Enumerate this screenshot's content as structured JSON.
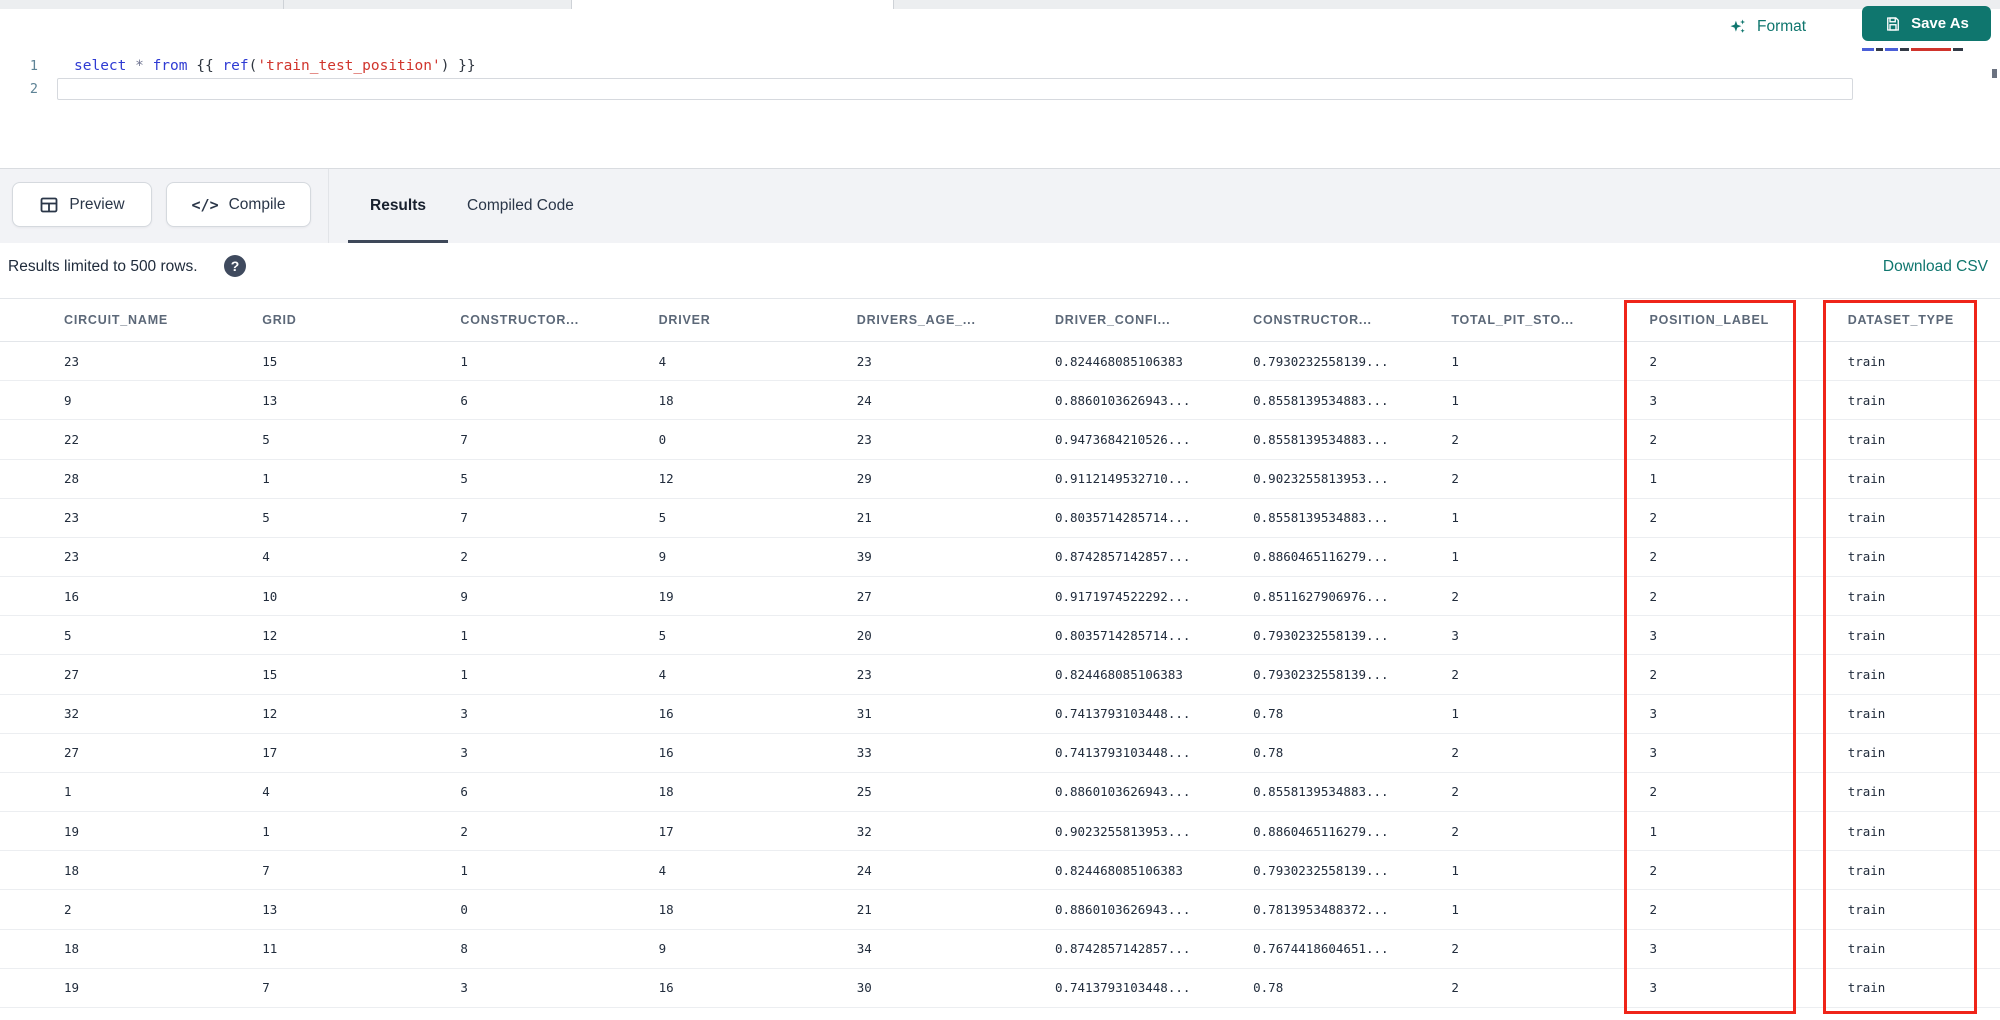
{
  "toolbar": {
    "format_label": "Format",
    "save_as_label": "Save As"
  },
  "editor": {
    "line1_number": "1",
    "line2_number": "2",
    "code_tokens": [
      {
        "text": "select ",
        "type": "keyword"
      },
      {
        "text": "* ",
        "type": "operator"
      },
      {
        "text": "from ",
        "type": "keyword"
      },
      {
        "text": "{{ ",
        "type": "plain"
      },
      {
        "text": "ref",
        "type": "function"
      },
      {
        "text": "(",
        "type": "plain"
      },
      {
        "text": "'train_test_position'",
        "type": "string"
      },
      {
        "text": ") ",
        "type": "plain"
      },
      {
        "text": "}}",
        "type": "plain"
      }
    ]
  },
  "panel": {
    "preview_label": "Preview",
    "compile_label": "Compile",
    "tabs": [
      {
        "label": "Results",
        "active": true
      },
      {
        "label": "Compiled Code",
        "active": false
      }
    ]
  },
  "results": {
    "limit_text": "Results limited to 500 rows.",
    "help_glyph": "?",
    "download_label": "Download CSV"
  },
  "table": {
    "columns": [
      "CIRCUIT_NAME",
      "GRID",
      "CONSTRUCTOR...",
      "DRIVER",
      "DRIVERS_AGE_...",
      "DRIVER_CONFI...",
      "CONSTRUCTOR...",
      "TOTAL_PIT_STO...",
      "POSITION_LABEL",
      "DATASET_TYPE"
    ],
    "rows": [
      [
        "23",
        "15",
        "1",
        "4",
        "23",
        "0.824468085106383",
        "0.7930232558139...",
        "1",
        "2",
        "train"
      ],
      [
        "9",
        "13",
        "6",
        "18",
        "24",
        "0.8860103626943...",
        "0.8558139534883...",
        "1",
        "3",
        "train"
      ],
      [
        "22",
        "5",
        "7",
        "0",
        "23",
        "0.9473684210526...",
        "0.8558139534883...",
        "2",
        "2",
        "train"
      ],
      [
        "28",
        "1",
        "5",
        "12",
        "29",
        "0.9112149532710...",
        "0.9023255813953...",
        "2",
        "1",
        "train"
      ],
      [
        "23",
        "5",
        "7",
        "5",
        "21",
        "0.8035714285714...",
        "0.8558139534883...",
        "1",
        "2",
        "train"
      ],
      [
        "23",
        "4",
        "2",
        "9",
        "39",
        "0.8742857142857...",
        "0.8860465116279...",
        "1",
        "2",
        "train"
      ],
      [
        "16",
        "10",
        "9",
        "19",
        "27",
        "0.9171974522292...",
        "0.8511627906976...",
        "2",
        "2",
        "train"
      ],
      [
        "5",
        "12",
        "1",
        "5",
        "20",
        "0.8035714285714...",
        "0.7930232558139...",
        "3",
        "3",
        "train"
      ],
      [
        "27",
        "15",
        "1",
        "4",
        "23",
        "0.824468085106383",
        "0.7930232558139...",
        "2",
        "2",
        "train"
      ],
      [
        "32",
        "12",
        "3",
        "16",
        "31",
        "0.7413793103448...",
        "0.78",
        "1",
        "3",
        "train"
      ],
      [
        "27",
        "17",
        "3",
        "16",
        "33",
        "0.7413793103448...",
        "0.78",
        "2",
        "3",
        "train"
      ],
      [
        "1",
        "4",
        "6",
        "18",
        "25",
        "0.8860103626943...",
        "0.8558139534883...",
        "2",
        "2",
        "train"
      ],
      [
        "19",
        "1",
        "2",
        "17",
        "32",
        "0.9023255813953...",
        "0.8860465116279...",
        "2",
        "1",
        "train"
      ],
      [
        "18",
        "7",
        "1",
        "4",
        "24",
        "0.824468085106383",
        "0.7930232558139...",
        "1",
        "2",
        "train"
      ],
      [
        "2",
        "13",
        "0",
        "18",
        "21",
        "0.8860103626943...",
        "0.7813953488372...",
        "1",
        "2",
        "train"
      ],
      [
        "18",
        "11",
        "8",
        "9",
        "34",
        "0.8742857142857...",
        "0.7674418604651...",
        "2",
        "3",
        "train"
      ],
      [
        "19",
        "7",
        "3",
        "16",
        "30",
        "0.7413793103448...",
        "0.78",
        "2",
        "3",
        "train"
      ]
    ],
    "highlighted_columns": [
      "POSITION_LABEL",
      "DATASET_TYPE"
    ]
  },
  "colors": {
    "accent_teal": "#0f766e",
    "annotation_red": "#ef2419"
  }
}
